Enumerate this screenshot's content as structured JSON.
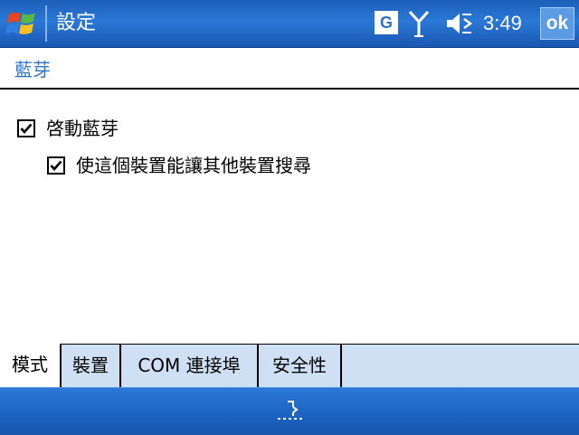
{
  "titlebar": {
    "title": "設定",
    "gprs_label": "G",
    "time": "3:49",
    "ok_label": "ok",
    "icons": [
      "windows-start-icon",
      "signal-antenna-icon",
      "volume-muted-icon"
    ]
  },
  "page": {
    "heading": "藍芽"
  },
  "options": {
    "enable_bluetooth": {
      "label": "啓動藍芽",
      "checked": true
    },
    "discoverable": {
      "label": "使這個裝置能讓其他裝置搜尋",
      "checked": true
    }
  },
  "tabs": [
    {
      "label": "模式",
      "active": true
    },
    {
      "label": "裝置",
      "active": false
    },
    {
      "label": "COM 連接埠",
      "active": false
    },
    {
      "label": "安全性",
      "active": false
    }
  ],
  "bottombar": {
    "icons": [
      "keyboard-input-icon"
    ]
  }
}
